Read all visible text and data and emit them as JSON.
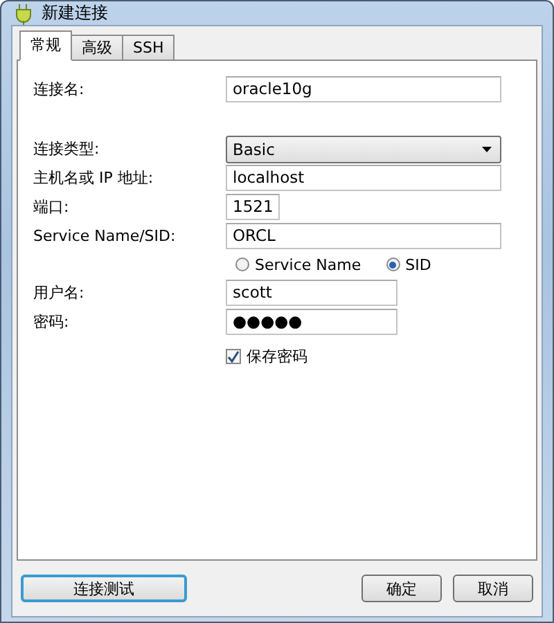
{
  "window": {
    "title": "新建连接"
  },
  "tabs": [
    {
      "label": "常规",
      "selected": true
    },
    {
      "label": "高级",
      "selected": false
    },
    {
      "label": "SSH",
      "selected": false
    }
  ],
  "form": {
    "fields": [
      {
        "kind": "text",
        "label": "连接名:",
        "value": "oracle10g"
      },
      {
        "kind": "spacer"
      },
      {
        "kind": "select",
        "label": "连接类型:",
        "value": "Basic"
      },
      {
        "kind": "text",
        "label": "主机名或 IP 地址:",
        "value": "localhost"
      },
      {
        "kind": "text",
        "label": "端口:",
        "value": "1521"
      },
      {
        "kind": "text",
        "label": "Service Name/SID:",
        "value": "ORCL"
      },
      {
        "kind": "radios",
        "options": [
          {
            "label": "Service Name",
            "selected": false
          },
          {
            "label": "SID",
            "selected": true
          }
        ]
      },
      {
        "kind": "text",
        "label": "用户名:",
        "value": "scott"
      },
      {
        "kind": "text",
        "label": "密码:",
        "value": "●●●●●"
      },
      {
        "kind": "checkbox",
        "label": "保存密码",
        "checked": true
      }
    ]
  },
  "buttons": [
    {
      "label": "连接测试",
      "focused": true
    },
    {
      "label": "确定",
      "focused": false
    },
    {
      "label": "取消",
      "focused": false
    }
  ]
}
